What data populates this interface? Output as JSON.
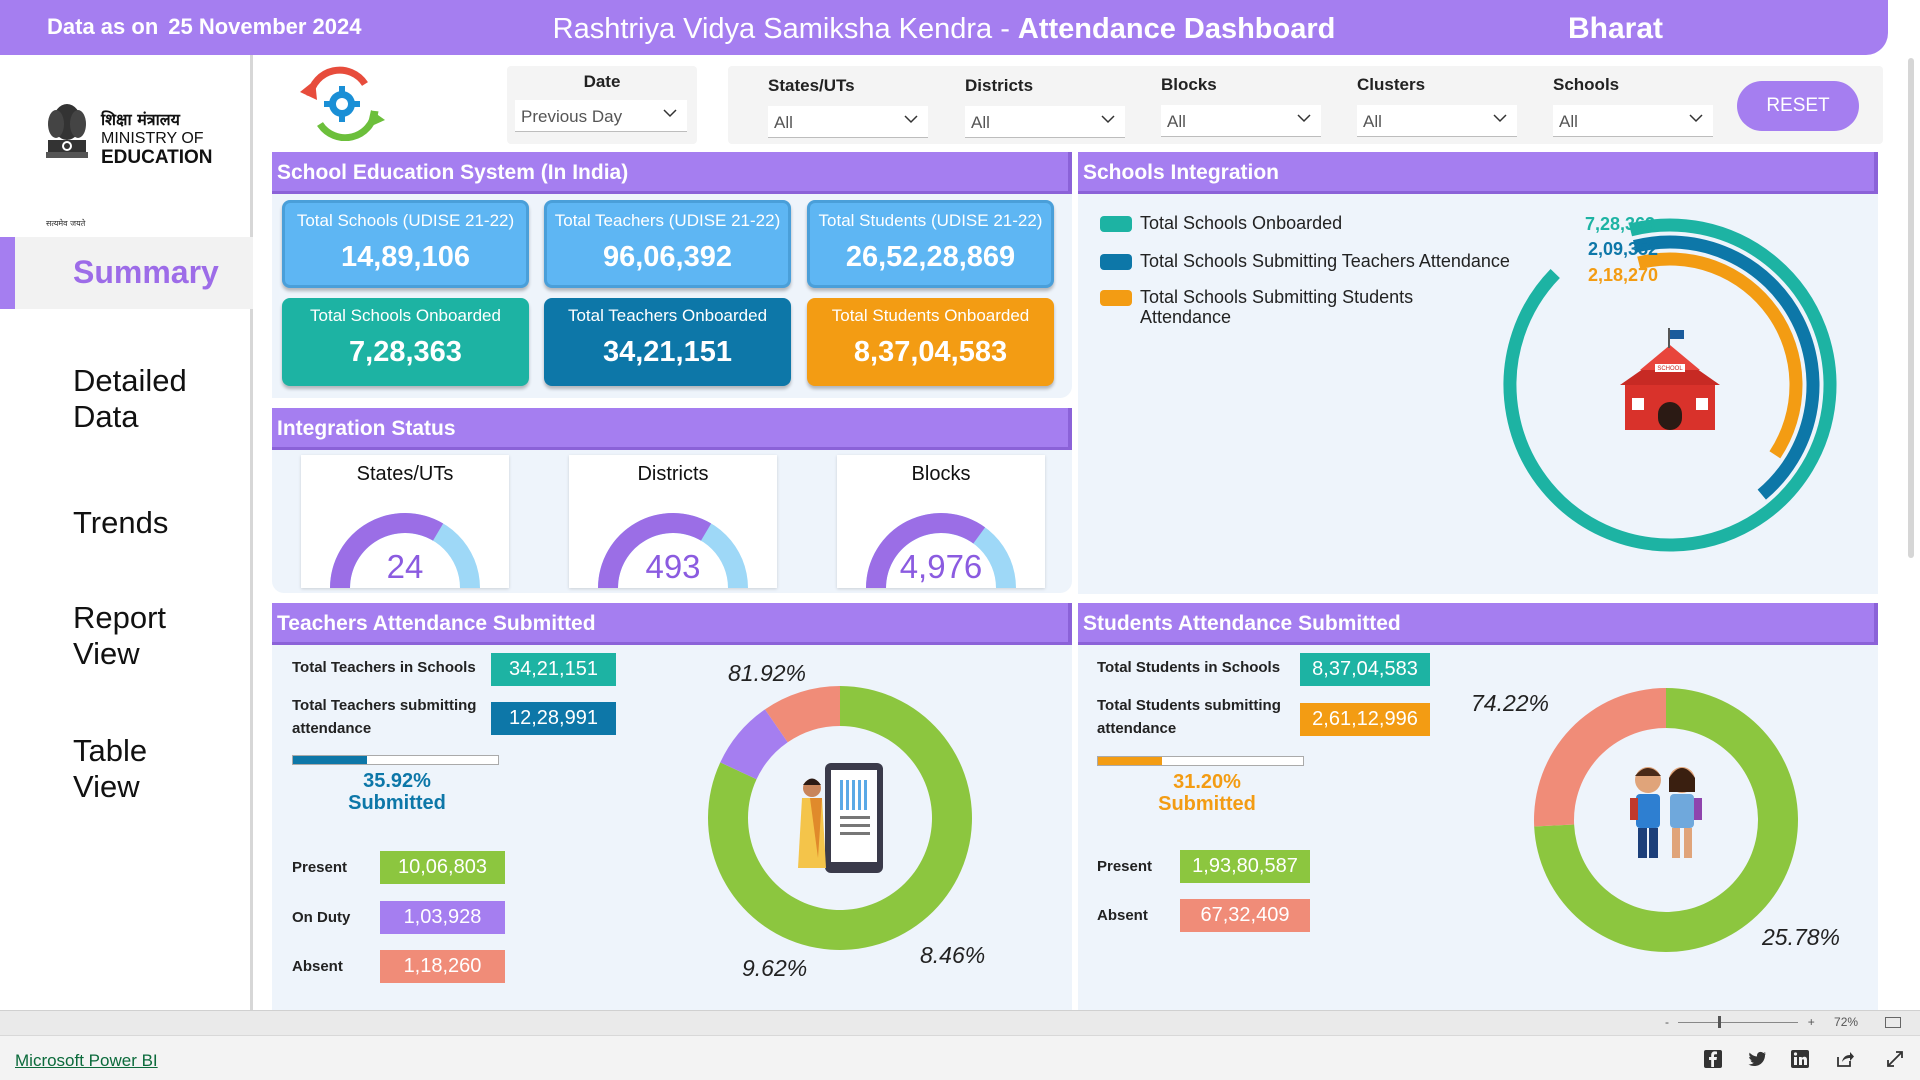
{
  "header": {
    "date_prefix": "Data as on",
    "date_value": "25 November 2024",
    "title_part1": "Rashtriya Vidya Samiksha Kendra -",
    "title_part2": "Attendance Dashboard",
    "region": "Bharat"
  },
  "logo": {
    "hindi": "शिक्षा मंत्रालय",
    "ministry": "MINISTRY OF",
    "education": "EDUCATION",
    "emblem_caption": "सत्यमेव जयते"
  },
  "nav": {
    "summary": "Summary",
    "detailed_1": "Detailed",
    "detailed_2": "Data",
    "trends": "Trends",
    "report_1": "Report",
    "report_2": "View",
    "table_1": "Table",
    "table_2": "View"
  },
  "filters": {
    "date_label": "Date",
    "date_value": "Previous Day",
    "states_label": "States/UTs",
    "states_value": "All",
    "districts_label": "Districts",
    "districts_value": "All",
    "blocks_label": "Blocks",
    "blocks_value": "All",
    "clusters_label": "Clusters",
    "clusters_value": "All",
    "schools_label": "Schools",
    "schools_value": "All",
    "reset": "RESET"
  },
  "school_system": {
    "title": "School Education System (In India)",
    "cards": [
      {
        "label": "Total Schools (UDISE 21-22)",
        "value": "14,89,106"
      },
      {
        "label": "Total Teachers (UDISE 21-22)",
        "value": "96,06,392"
      },
      {
        "label": "Total Students (UDISE 21-22)",
        "value": "26,52,28,869"
      },
      {
        "label": "Total Schools Onboarded",
        "value": "7,28,363"
      },
      {
        "label": "Total Teachers Onboarded",
        "value": "34,21,151"
      },
      {
        "label": "Total Students Onboarded",
        "value": "8,37,04,583"
      }
    ]
  },
  "integration_status": {
    "title": "Integration Status",
    "gauges": [
      {
        "title": "States/UTs",
        "value": "24",
        "fill": 0.67
      },
      {
        "title": "Districts",
        "value": "493",
        "fill": 0.67
      },
      {
        "title": "Blocks",
        "value": "4,976",
        "fill": 0.7
      }
    ]
  },
  "schools_integration": {
    "title": "Schools Integration",
    "legend": [
      {
        "label": "Total Schools Onboarded",
        "color": "#1db3a3"
      },
      {
        "label": "Total Schools Submitting Teachers Attendance",
        "color": "#0d77a8"
      },
      {
        "label": "Total Schools Submitting Students Attendance",
        "color": "#f39c13"
      }
    ],
    "values": [
      "7,28,363",
      "2,09,352",
      "2,18,270"
    ],
    "raw": [
      728363,
      209352,
      218270
    ],
    "school_sign": "SCHOOL"
  },
  "teachers": {
    "title": "Teachers Attendance Submitted",
    "total_label": "Total Teachers in Schools",
    "total_value": "34,21,151",
    "submitting_label_1": "Total Teachers submitting",
    "submitting_label_2": "attendance",
    "submitting_value": "12,28,991",
    "pct": "35.92%",
    "pct_fraction": 0.3592,
    "submitted": "Submitted",
    "present_label": "Present",
    "present_value": "10,06,803",
    "onduty_label": "On Duty",
    "onduty_value": "1,03,928",
    "absent_label": "Absent",
    "absent_value": "1,18,260",
    "donut": [
      {
        "name": "Present",
        "pct": 81.92,
        "label": "81.92%",
        "color": "#8cc63f"
      },
      {
        "name": "On Duty",
        "pct": 8.46,
        "label": "8.46%",
        "color": "#a57ef0"
      },
      {
        "name": "Absent",
        "pct": 9.62,
        "label": "9.62%",
        "color": "#f08c78"
      }
    ]
  },
  "students": {
    "title": "Students Attendance Submitted",
    "total_label": "Total Students in Schools",
    "total_value": "8,37,04,583",
    "submitting_label_1": "Total Students submitting",
    "submitting_label_2": "attendance",
    "submitting_value": "2,61,12,996",
    "pct": "31.20%",
    "pct_fraction": 0.312,
    "submitted": "Submitted",
    "present_label": "Present",
    "present_value": "1,93,80,587",
    "absent_label": "Absent",
    "absent_value": "67,32,409",
    "donut": [
      {
        "name": "Present",
        "pct": 74.22,
        "label": "74.22%",
        "color": "#8cc63f"
      },
      {
        "name": "Absent",
        "pct": 25.78,
        "label": "25.78%",
        "color": "#f08c78"
      }
    ]
  },
  "status_bar": {
    "zoom": "72%",
    "minus": "-",
    "plus": "+"
  },
  "footer": {
    "link": "Microsoft Power BI"
  },
  "colors": {
    "accent": "#a57ef0",
    "teal": "#1db3a3",
    "navy": "#0d77a8",
    "orange": "#f39c13",
    "green": "#8cc63f",
    "salmon": "#f08c78",
    "sky": "#5eb6f3"
  }
}
